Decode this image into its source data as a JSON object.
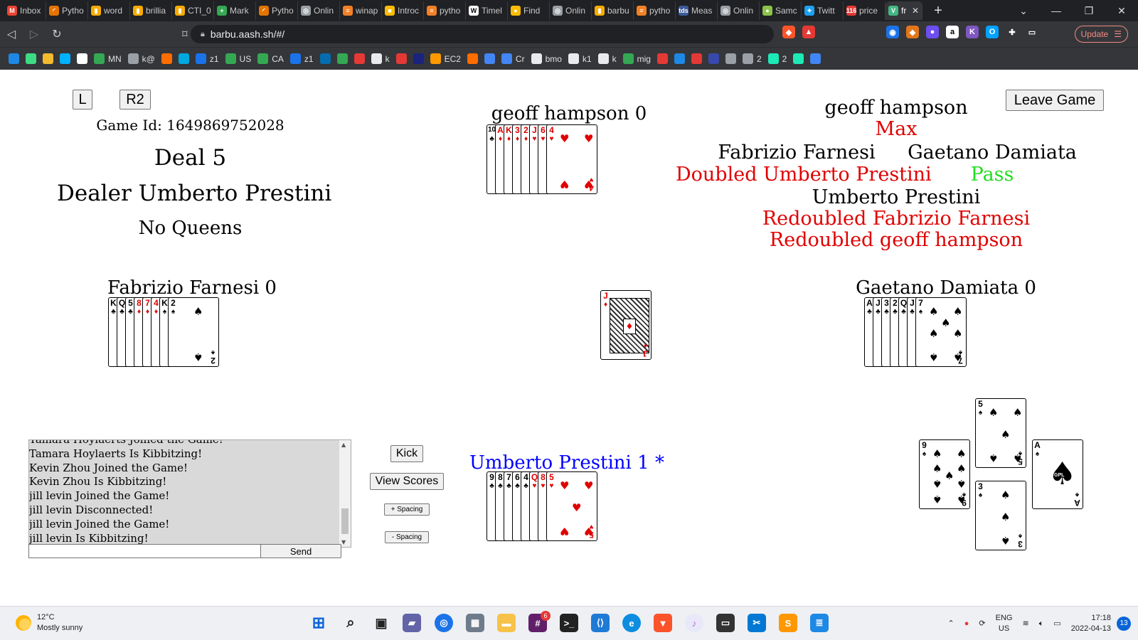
{
  "browser": {
    "tabs": [
      {
        "label": "Inbox",
        "icon": "gmail-icon",
        "color": "#ea4335",
        "glyph": "M"
      },
      {
        "label": "Pytho",
        "icon": "loading-icon",
        "color": "#e37400",
        "glyph": "◜"
      },
      {
        "label": "word",
        "icon": "book-icon",
        "color": "#f9ab00",
        "glyph": "▮"
      },
      {
        "label": "brillia",
        "icon": "book-icon",
        "color": "#f9ab00",
        "glyph": "▮"
      },
      {
        "label": "CTI_0",
        "icon": "book-icon",
        "color": "#f9ab00",
        "glyph": "▮"
      },
      {
        "label": "Mark",
        "icon": "sheets-icon",
        "color": "#34a853",
        "glyph": "+"
      },
      {
        "label": "Pytho",
        "icon": "loading-icon",
        "color": "#e37400",
        "glyph": "◜"
      },
      {
        "label": "Onlin",
        "icon": "globe-icon",
        "color": "#9aa0a6",
        "glyph": "◎"
      },
      {
        "label": "winap",
        "icon": "stackoverflow-icon",
        "color": "#f48024",
        "glyph": "≡"
      },
      {
        "label": "Introc",
        "icon": "note-icon",
        "color": "#fbbc04",
        "glyph": "■"
      },
      {
        "label": "pytho",
        "icon": "stackoverflow-icon",
        "color": "#f48024",
        "glyph": "≡"
      },
      {
        "label": "Timel",
        "icon": "wikipedia-icon",
        "color": "#ffffff",
        "glyph": "W"
      },
      {
        "label": "Find",
        "icon": "sun-icon",
        "color": "#fbbc04",
        "glyph": "●"
      },
      {
        "label": "Onlin",
        "icon": "globe-icon",
        "color": "#9aa0a6",
        "glyph": "◎"
      },
      {
        "label": "barbu",
        "icon": "book-icon",
        "color": "#f9ab00",
        "glyph": "▮"
      },
      {
        "label": "pytho",
        "icon": "stackoverflow-icon",
        "color": "#f48024",
        "glyph": "≡"
      },
      {
        "label": "Meas",
        "icon": "tds-icon",
        "color": "#3c5a99",
        "glyph": "tds"
      },
      {
        "label": "Onlin",
        "icon": "globe-icon",
        "color": "#9aa0a6",
        "glyph": "◎"
      },
      {
        "label": "Samc",
        "icon": "samcart-icon",
        "color": "#8bc34a",
        "glyph": "●"
      },
      {
        "label": "Twitt",
        "icon": "twitter-icon",
        "color": "#1da1f2",
        "glyph": "✦"
      },
      {
        "label": "price",
        "icon": "badge-icon",
        "color": "#e53935",
        "glyph": "116"
      },
      {
        "label": "fr",
        "icon": "vue-icon",
        "color": "#42b883",
        "glyph": "V"
      }
    ],
    "url": "barbu.aash.sh/#/",
    "update_label": "Update",
    "bookmarks": [
      {
        "label": "",
        "icon": "play-icon",
        "color": "#1e88e5"
      },
      {
        "label": "",
        "icon": "android-icon",
        "color": "#3ddc84"
      },
      {
        "label": "",
        "icon": "binance-icon",
        "color": "#f3ba2f"
      },
      {
        "label": "",
        "icon": "dollar-icon",
        "color": "#00b2ff"
      },
      {
        "label": "",
        "icon": "circle-icon",
        "color": "#ffffff"
      },
      {
        "label": "MN",
        "icon": "sheets-icon",
        "color": "#34a853"
      },
      {
        "label": "k@",
        "icon": "mail-icon",
        "color": "#9aa0a6"
      },
      {
        "label": "",
        "icon": "orange-dot-icon",
        "color": "#ff6d00"
      },
      {
        "label": "",
        "icon": "att-icon",
        "color": "#00a8e0"
      },
      {
        "label": "z1",
        "icon": "gear-icon",
        "color": "#1a73e8"
      },
      {
        "label": "US",
        "icon": "td-icon",
        "color": "#34a853"
      },
      {
        "label": "CA",
        "icon": "td-icon",
        "color": "#34a853"
      },
      {
        "label": "z1",
        "icon": "grid-icon",
        "color": "#1a73e8"
      },
      {
        "label": "",
        "icon": "citi-icon",
        "color": "#056dae"
      },
      {
        "label": "",
        "icon": "td-icon",
        "color": "#34a853"
      },
      {
        "label": "",
        "icon": "badge-icon",
        "color": "#e53935"
      },
      {
        "label": "k",
        "icon": "globe-icon",
        "color": "#e8eaed"
      },
      {
        "label": "",
        "icon": "shield-icon",
        "color": "#e53935"
      },
      {
        "label": "",
        "icon": "bank-icon",
        "color": "#1a237e"
      },
      {
        "label": "EC2",
        "icon": "aws-icon",
        "color": "#ff9900"
      },
      {
        "label": "",
        "icon": "star-icon",
        "color": "#ff6d00"
      },
      {
        "label": "",
        "icon": "chart-icon",
        "color": "#4285f4"
      },
      {
        "label": "Cr",
        "icon": "doc-icon",
        "color": "#4285f4"
      },
      {
        "label": "bmo",
        "icon": "globe-icon",
        "color": "#e8eaed"
      },
      {
        "label": "k1",
        "icon": "globe-icon",
        "color": "#e8eaed"
      },
      {
        "label": "k",
        "icon": "globe-icon",
        "color": "#e8eaed"
      },
      {
        "label": "mig",
        "icon": "sheets-icon",
        "color": "#34a853"
      },
      {
        "label": "",
        "icon": "m-icon",
        "color": "#e53935"
      },
      {
        "label": "",
        "icon": "wave-icon",
        "color": "#1e88e5"
      },
      {
        "label": "",
        "icon": "check-icon",
        "color": "#e53935"
      },
      {
        "label": "",
        "icon": "z-icon",
        "color": "#3949ab"
      },
      {
        "label": "",
        "icon": "moon-icon",
        "color": "#9aa0a6"
      },
      {
        "label": "2",
        "icon": "moon-icon",
        "color": "#9aa0a6"
      },
      {
        "label": "2",
        "icon": "target-icon",
        "color": "#1de9b6"
      },
      {
        "label": "",
        "icon": "puzzle-icon",
        "color": "#1de9b6"
      },
      {
        "label": "",
        "icon": "circle-icon",
        "color": "#4285f4"
      }
    ]
  },
  "game": {
    "buttons": {
      "l": "L",
      "r2": "R2",
      "leave": "Leave Game",
      "kick": "Kick",
      "view_scores": "View Scores",
      "plus_spacing": "+ Spacing",
      "minus_spacing": "- Spacing",
      "send": "Send"
    },
    "game_id": "Game Id: 1649869752028",
    "deal": "Deal 5",
    "dealer": "Dealer Umberto Prestini",
    "contract": "No Queens",
    "players": {
      "north": {
        "label": "geoff hampson 0"
      },
      "west": {
        "label": "Fabrizio Farnesi 0"
      },
      "east": {
        "label": "Gaetano Damiata 0"
      },
      "south": {
        "label": "Umberto Prestini 1 *"
      }
    },
    "bidding": {
      "north_name": "geoff hampson",
      "north_call": "Max",
      "west_name": "Fabrizio Farnesi",
      "west_call": "Doubled Umberto Prestini",
      "east_name": "Gaetano Damiata",
      "east_call": "Pass",
      "south_name": "Umberto Prestini",
      "south_call_1": "Redoubled Fabrizio Farnesi",
      "south_call_2": "Redoubled geoff hampson"
    },
    "colors": {
      "call_red": "#e00000",
      "pass_green": "#22dd22",
      "current_player": "#0000ff"
    },
    "hands": {
      "north": [
        [
          "10",
          "♣"
        ],
        [
          "A",
          "♦"
        ],
        [
          "K",
          "♦"
        ],
        [
          "3",
          "♦"
        ],
        [
          "2",
          "♦"
        ],
        [
          "J",
          "♥"
        ],
        [
          "6",
          "♥"
        ],
        [
          "4",
          "♥"
        ]
      ],
      "west": [
        [
          "K",
          "♣"
        ],
        [
          "Q",
          "♣"
        ],
        [
          "5",
          "♣"
        ],
        [
          "8",
          "♦"
        ],
        [
          "7",
          "♦"
        ],
        [
          "4",
          "♦"
        ],
        [
          "K",
          "♠"
        ],
        [
          "2",
          "♠"
        ]
      ],
      "east": [
        [
          "A",
          "♣"
        ],
        [
          "J",
          "♣"
        ],
        [
          "3",
          "♣"
        ],
        [
          "2",
          "♣"
        ],
        [
          "Q",
          "♣"
        ],
        [
          "J",
          "♣"
        ],
        [
          "7",
          "♠"
        ]
      ],
      "south": [
        [
          "9",
          "♣"
        ],
        [
          "8",
          "♣"
        ],
        [
          "7",
          "♣"
        ],
        [
          "6",
          "♣"
        ],
        [
          "4",
          "♣"
        ],
        [
          "Q",
          "♥"
        ],
        [
          "8",
          "♥"
        ],
        [
          "5",
          "♥"
        ]
      ]
    },
    "center_card": [
      "J",
      "♦"
    ],
    "trick_cards": {
      "top": [
        "5",
        "♠"
      ],
      "left": [
        "9",
        "♠"
      ],
      "bottom": [
        "3",
        "♠"
      ],
      "right": [
        "A",
        "♠"
      ],
      "right_logo": "GPL"
    },
    "chat": [
      "Tamara Hoylaerts Joined the Game!",
      "Tamara Hoylaerts Is Kibbitzing!",
      "Kevin Zhou Joined the Game!",
      "Kevin Zhou Is Kibbitzing!",
      "jill levin Joined the Game!",
      "jill levin Disconnected!",
      "jill levin Joined the Game!",
      "jill levin Is Kibbitzing!"
    ],
    "chat_input": ""
  },
  "taskbar": {
    "temperature": "12°C",
    "weather": "Mostly sunny",
    "language_1": "ENG",
    "language_2": "US",
    "time": "17:18",
    "date": "2022-04-13",
    "notifications": "13",
    "slack_badge": "6"
  }
}
